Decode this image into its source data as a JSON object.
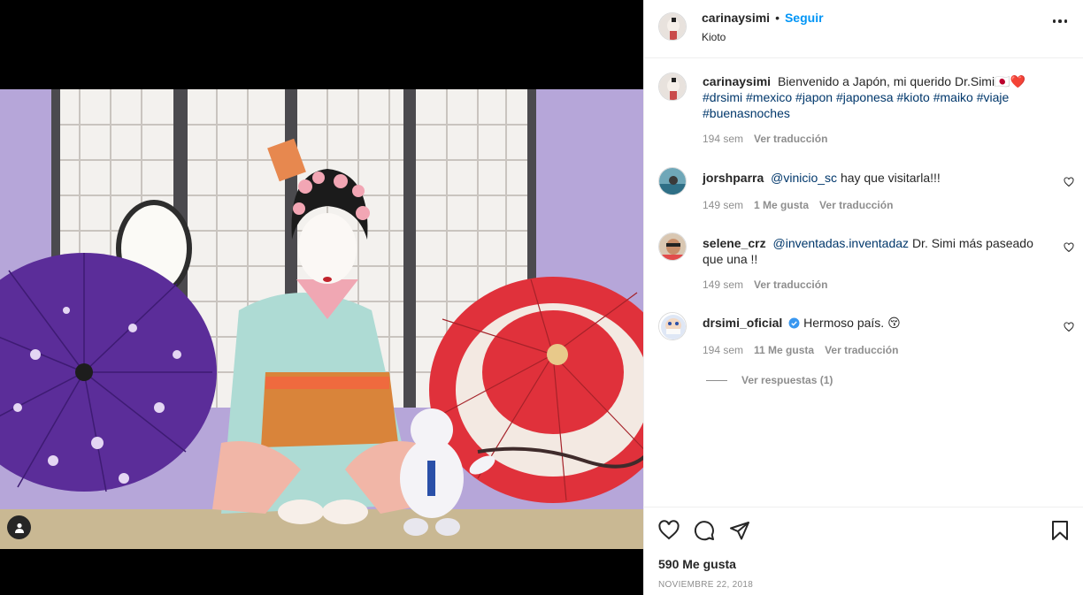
{
  "post": {
    "author": "carinaysimi",
    "follow_label": "Seguir",
    "location": "Kioto",
    "dot": "•"
  },
  "caption": {
    "user": "carinaysimi",
    "text": "Bienvenido a Japón, mi querido Dr.Simi🇯🇵❤️",
    "hashtags": "#drsimi #mexico #japon #japonesa #kioto #maiko #viaje #buenasnoches",
    "age": "194 sem",
    "translate": "Ver traducción"
  },
  "comments": [
    {
      "user": "jorshparra",
      "mention": "@vinicio_sc",
      "text": "hay que visitarla!!!",
      "age": "149 sem",
      "likes": "1 Me gusta",
      "translate": "Ver traducción"
    },
    {
      "user": "selene_crz",
      "mention": "@inventadas.inventadaz",
      "text": "Dr. Simi más paseado que una !!",
      "age": "149 sem",
      "likes": "",
      "translate": "Ver traducción"
    },
    {
      "user": "drsimi_oficial",
      "mention": "",
      "text": "Hermoso país. 😚",
      "age": "194 sem",
      "likes": "11 Me gusta",
      "translate": "Ver traducción",
      "replies": "Ver respuestas (1)"
    }
  ],
  "footer": {
    "likes": "590 Me gusta",
    "date": "NOVIEMBRE 22, 2018"
  },
  "icons": {
    "heart": "heart-icon",
    "comment": "comment-icon",
    "share": "share-icon",
    "save": "bookmark-icon",
    "more": "more-icon",
    "tag": "user-tag-icon",
    "verified": "verified-badge-icon"
  },
  "colors": {
    "accent": "#0095f6",
    "hashtag": "#00376b",
    "secondary_text": "#8e8e8e",
    "verified": "#3897f0"
  }
}
